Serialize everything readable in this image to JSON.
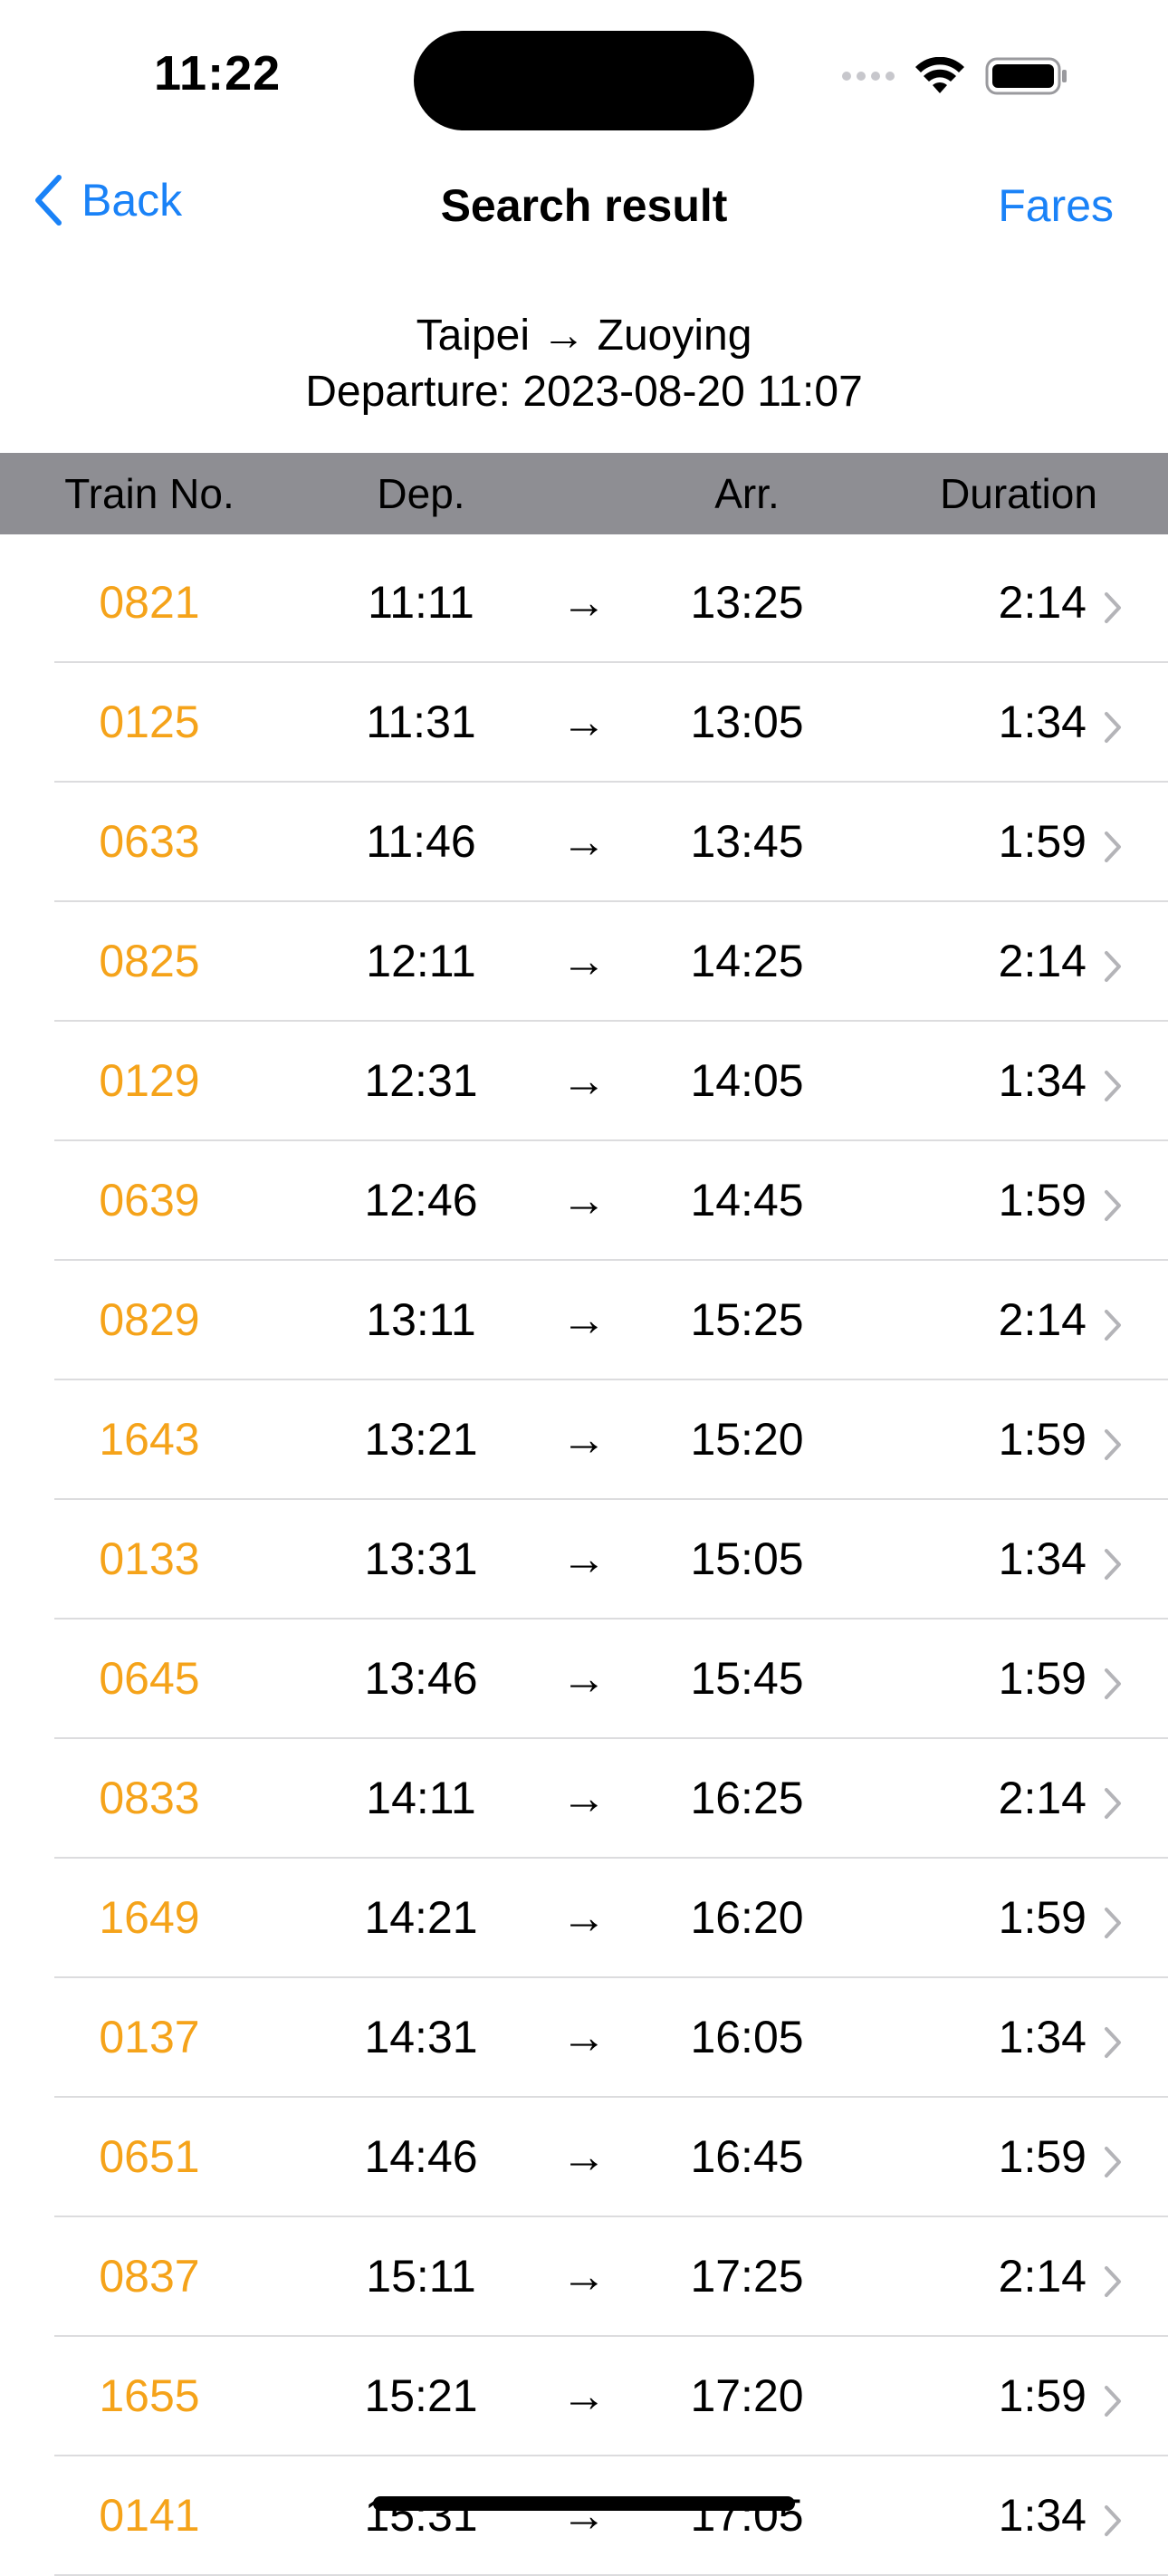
{
  "status_bar": {
    "time": "11:22",
    "icons": [
      "cellular-signal-icon",
      "wifi-icon",
      "battery-icon"
    ]
  },
  "nav": {
    "back_label": "Back",
    "title": "Search result",
    "fares_label": "Fares"
  },
  "route": {
    "line1": "Taipei → Zuoying",
    "line2": "Departure: 2023-08-20 11:07"
  },
  "columns": {
    "train_no": "Train No.",
    "dep": "Dep.",
    "arr": "Arr.",
    "duration": "Duration"
  },
  "colors": {
    "accent_blue": "#1a82f7",
    "train_orange": "#f5a31a",
    "header_gray": "#8e8e93"
  },
  "rows": [
    {
      "train": "0821",
      "dep": "11:11",
      "arrow": "→",
      "arr": "13:25",
      "dur": "2:14"
    },
    {
      "train": "0125",
      "dep": "11:31",
      "arrow": "→",
      "arr": "13:05",
      "dur": "1:34"
    },
    {
      "train": "0633",
      "dep": "11:46",
      "arrow": "→",
      "arr": "13:45",
      "dur": "1:59"
    },
    {
      "train": "0825",
      "dep": "12:11",
      "arrow": "→",
      "arr": "14:25",
      "dur": "2:14"
    },
    {
      "train": "0129",
      "dep": "12:31",
      "arrow": "→",
      "arr": "14:05",
      "dur": "1:34"
    },
    {
      "train": "0639",
      "dep": "12:46",
      "arrow": "→",
      "arr": "14:45",
      "dur": "1:59"
    },
    {
      "train": "0829",
      "dep": "13:11",
      "arrow": "→",
      "arr": "15:25",
      "dur": "2:14"
    },
    {
      "train": "1643",
      "dep": "13:21",
      "arrow": "→",
      "arr": "15:20",
      "dur": "1:59"
    },
    {
      "train": "0133",
      "dep": "13:31",
      "arrow": "→",
      "arr": "15:05",
      "dur": "1:34"
    },
    {
      "train": "0645",
      "dep": "13:46",
      "arrow": "→",
      "arr": "15:45",
      "dur": "1:59"
    },
    {
      "train": "0833",
      "dep": "14:11",
      "arrow": "→",
      "arr": "16:25",
      "dur": "2:14"
    },
    {
      "train": "1649",
      "dep": "14:21",
      "arrow": "→",
      "arr": "16:20",
      "dur": "1:59"
    },
    {
      "train": "0137",
      "dep": "14:31",
      "arrow": "→",
      "arr": "16:05",
      "dur": "1:34"
    },
    {
      "train": "0651",
      "dep": "14:46",
      "arrow": "→",
      "arr": "16:45",
      "dur": "1:59"
    },
    {
      "train": "0837",
      "dep": "15:11",
      "arrow": "→",
      "arr": "17:25",
      "dur": "2:14"
    },
    {
      "train": "1655",
      "dep": "15:21",
      "arrow": "→",
      "arr": "17:20",
      "dur": "1:59"
    },
    {
      "train": "0141",
      "dep": "15:31",
      "arrow": "→",
      "arr": "17:05",
      "dur": "1:34"
    }
  ]
}
